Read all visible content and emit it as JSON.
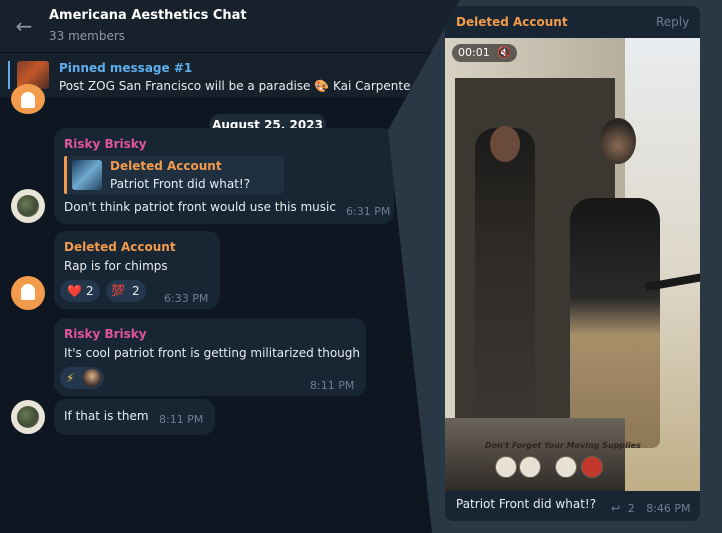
{
  "header": {
    "back_icon": "arrow-left-icon",
    "title": "Americana Aesthetics Chat",
    "members": "33 members"
  },
  "pinned": {
    "title": "Pinned message #1",
    "text": "Post ZOG San Francisco will be a paradise 🎨 Kai Carpente"
  },
  "date_separator": "August 25, 2023",
  "messages": [
    {
      "sender": "Risky Brisky",
      "reply_to": {
        "sender": "Deleted Account",
        "text": "Patriot Front did what!?"
      },
      "text": "Don't think patriot front would use this music",
      "time": "6:31 PM"
    },
    {
      "sender": "Deleted Account",
      "text": "Rap is for chimps",
      "time": "6:33 PM",
      "reactions": [
        {
          "emoji": "❤️",
          "count": "2"
        },
        {
          "emoji": "💯",
          "count": "2"
        }
      ]
    },
    {
      "sender": "Risky Brisky",
      "text": "It's cool patriot front is getting militarized though",
      "time": "8:11 PM",
      "reactions": [
        {
          "emoji": "⚡"
        }
      ]
    },
    {
      "text": "If that is them",
      "time": "8:11 PM"
    }
  ],
  "quoted_message": {
    "sender": "Deleted Account",
    "reply_label": "Reply",
    "video": {
      "duration": "00:01",
      "mute_icon": "speaker-muted-icon",
      "sign_text": "Don't Forget Your Moving Supplies"
    },
    "caption": "Patriot Front did what!?",
    "reply_count": "2",
    "time": "8:46 PM"
  },
  "colors": {
    "background": "#0e1621",
    "bubble": "#182533",
    "accent_blue": "#5eaef0",
    "sender_pink": "#e0569a",
    "sender_orange": "#f29b4c"
  }
}
